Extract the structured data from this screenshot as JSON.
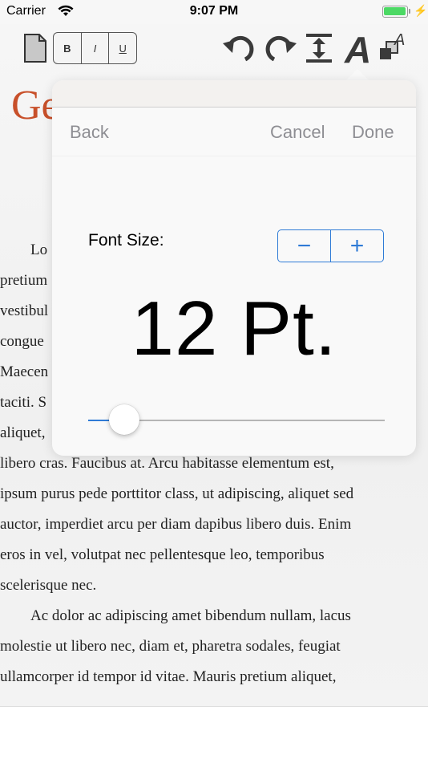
{
  "status_bar": {
    "carrier": "Carrier",
    "time": "9:07 PM",
    "battery_fill": 0.95
  },
  "toolbar": {
    "bold_label": "B",
    "italic_label": "I",
    "underline_label": "U",
    "icons": [
      "document-icon",
      "undo-icon",
      "redo-icon",
      "line-spacing-icon",
      "font-icon",
      "text-color-icon"
    ]
  },
  "document": {
    "title": "Ge",
    "lines": [
      "Lo",
      "pretium",
      "vestibul",
      "congue",
      "Maecen",
      "taciti. S",
      "aliquet,",
      "libero cras. Faucibus at. Arcu habitasse elementum est,",
      "ipsum purus pede porttitor class, ut adipiscing, aliquet sed",
      "auctor, imperdiet arcu per diam dapibus libero duis. Enim",
      "eros in vel, volutpat nec pellentesque leo, temporibus",
      "scelerisque nec.",
      "Ac dolor ac adipiscing amet bibendum nullam, lacus",
      "molestie ut libero nec, diam et, pharetra sodales, feugiat",
      "ullamcorper id tempor id vitae. Mauris pretium aliquet,"
    ]
  },
  "popover": {
    "back_label": "Back",
    "cancel_label": "Cancel",
    "done_label": "Done",
    "font_size_label": "Font Size:",
    "stepper_minus": "−",
    "stepper_plus": "+",
    "size_display": "12 Pt.",
    "slider_value_fraction": 0.08
  },
  "colors": {
    "accent": "#2f7bd6",
    "title": "#c8502a",
    "nav_text": "#8e8e93"
  }
}
